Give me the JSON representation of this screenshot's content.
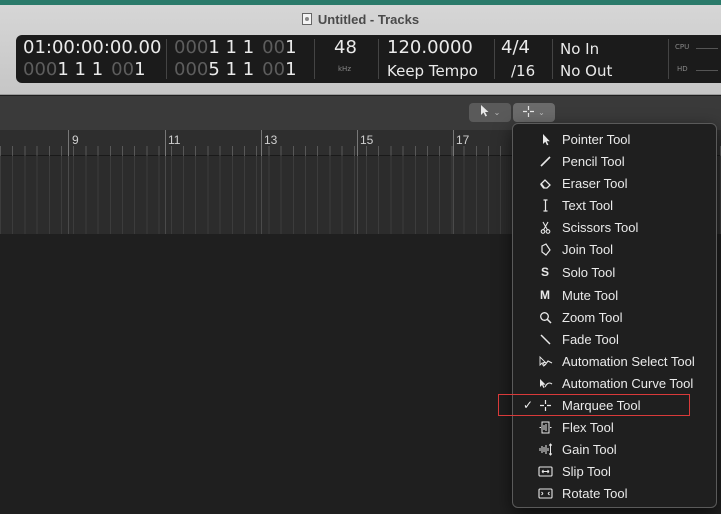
{
  "window": {
    "title": "Untitled - Tracks"
  },
  "lcd": {
    "position_time": "01:00:00:00.00",
    "position_bars": {
      "dim": "000",
      "value": "1  1  1",
      "dim2": "00",
      "tail": "1"
    },
    "start_row1": {
      "dim": "000",
      "value": "1  1  1",
      "dim2": "00",
      "tail": "1"
    },
    "start_row2": {
      "dim": "000",
      "value": "5  1  1",
      "dim2": "00",
      "tail": "1"
    },
    "sample_rate": "48",
    "sample_rate_unit": "kHz",
    "tempo": "120.0000",
    "tempo_mode": "Keep Tempo",
    "time_signature": "4/4",
    "division": "/16",
    "midi_in": "No In",
    "midi_out": "No Out",
    "cpu_label": "CPU",
    "hd_label": "HD"
  },
  "toolbar": {
    "left_tool_icon": "pointer-icon",
    "right_tool_icon": "marquee-icon"
  },
  "ruler": {
    "bars": [
      "9",
      "11",
      "13",
      "15",
      "17"
    ]
  },
  "tool_menu": {
    "selected": "Marquee Tool",
    "items": [
      {
        "label": "Pointer Tool",
        "icon": "pointer-icon",
        "check": ""
      },
      {
        "label": "Pencil Tool",
        "icon": "pencil-icon",
        "check": ""
      },
      {
        "label": "Eraser Tool",
        "icon": "eraser-icon",
        "check": ""
      },
      {
        "label": "Text Tool",
        "icon": "text-cursor-icon",
        "check": ""
      },
      {
        "label": "Scissors Tool",
        "icon": "scissors-icon",
        "check": ""
      },
      {
        "label": "Join Tool",
        "icon": "join-icon",
        "check": ""
      },
      {
        "label": "Solo Tool",
        "icon": "solo-icon",
        "glyph": "S",
        "check": ""
      },
      {
        "label": "Mute Tool",
        "icon": "mute-icon",
        "glyph": "M",
        "check": ""
      },
      {
        "label": "Zoom Tool",
        "icon": "magnifier-icon",
        "check": ""
      },
      {
        "label": "Fade Tool",
        "icon": "fade-icon",
        "check": ""
      },
      {
        "label": "Automation Select Tool",
        "icon": "automation-select-icon",
        "check": ""
      },
      {
        "label": "Automation Curve Tool",
        "icon": "automation-curve-icon",
        "check": ""
      },
      {
        "label": "Marquee Tool",
        "icon": "marquee-icon",
        "check": "✓"
      },
      {
        "label": "Flex Tool",
        "icon": "flex-icon",
        "check": ""
      },
      {
        "label": "Gain Tool",
        "icon": "gain-icon",
        "check": ""
      },
      {
        "label": "Slip Tool",
        "icon": "slip-icon",
        "check": ""
      },
      {
        "label": "Rotate Tool",
        "icon": "rotate-icon",
        "check": ""
      }
    ]
  },
  "colors": {
    "highlight": "#d93a3a",
    "accent_strip": "#2a7a6a"
  }
}
